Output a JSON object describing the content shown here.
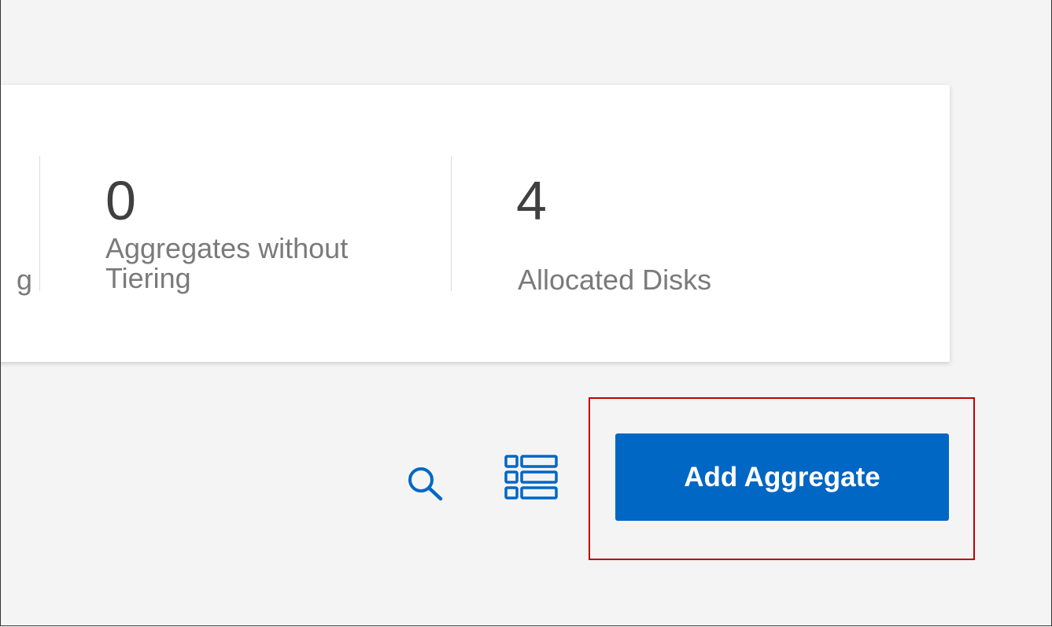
{
  "stats": [
    {
      "label_fragment": "g"
    },
    {
      "value": "0",
      "label_line1": "Aggregates without",
      "label_line2": "Tiering"
    },
    {
      "value": "4",
      "label": "Allocated Disks"
    }
  ],
  "toolbar": {
    "search_icon": "search-icon",
    "list_icon": "list-view-icon",
    "add_button_label": "Add Aggregate"
  },
  "colors": {
    "accent": "#0067c5",
    "highlight": "#c00000",
    "background": "#f4f4f4"
  }
}
